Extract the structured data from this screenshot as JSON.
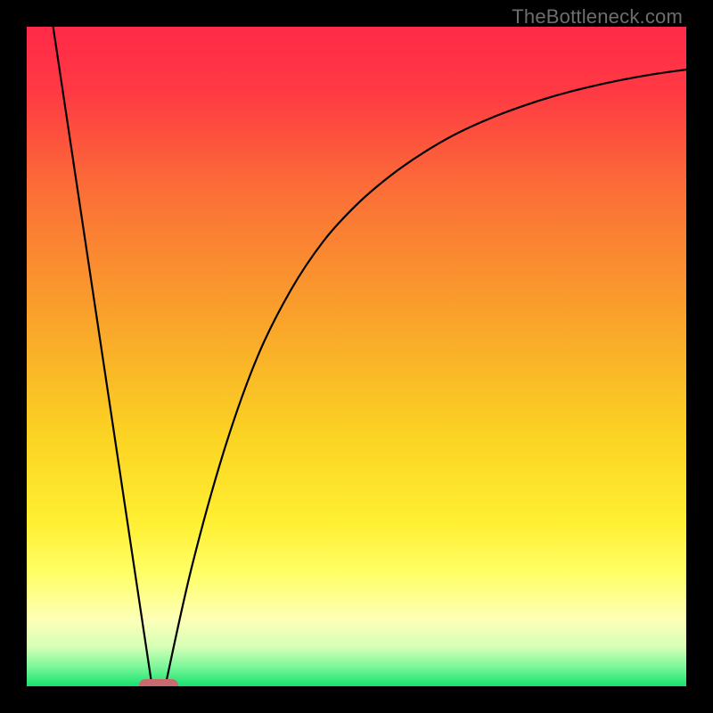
{
  "watermark": "TheBottleneck.com",
  "chart_data": {
    "type": "line",
    "title": "",
    "xlabel": "",
    "ylabel": "",
    "xlim": [
      0,
      100
    ],
    "ylim": [
      0,
      100
    ],
    "background_gradient": {
      "stops": [
        {
          "pos": 0.0,
          "color": "#ff2a48"
        },
        {
          "pos": 0.1,
          "color": "#ff3a43"
        },
        {
          "pos": 0.25,
          "color": "#fb6f37"
        },
        {
          "pos": 0.45,
          "color": "#f9a52a"
        },
        {
          "pos": 0.62,
          "color": "#fbd323"
        },
        {
          "pos": 0.75,
          "color": "#ffef32"
        },
        {
          "pos": 0.83,
          "color": "#ffff67"
        },
        {
          "pos": 0.9,
          "color": "#fdffb8"
        },
        {
          "pos": 0.94,
          "color": "#d6ffb6"
        },
        {
          "pos": 0.97,
          "color": "#7ef79a"
        },
        {
          "pos": 1.0,
          "color": "#16e26e"
        }
      ]
    },
    "series": [
      {
        "name": "left-descent",
        "type": "line",
        "x": [
          4,
          19
        ],
        "y": [
          100,
          0
        ],
        "stroke": "#000000"
      },
      {
        "name": "right-ascent",
        "type": "line",
        "x": [
          21,
          25,
          30,
          35,
          40,
          45,
          50,
          55,
          60,
          65,
          70,
          75,
          80,
          85,
          90,
          95,
          100
        ],
        "y": [
          0,
          18,
          36,
          50,
          60,
          67.5,
          73,
          77.3,
          80.8,
          83.7,
          86,
          87.9,
          89.5,
          90.8,
          91.9,
          92.8,
          93.5
        ],
        "stroke": "#000000"
      }
    ],
    "marker": {
      "shape": "rounded-rect",
      "x_center": 20,
      "y": 0,
      "width_pct": 6,
      "color": "#c96a6f"
    }
  }
}
